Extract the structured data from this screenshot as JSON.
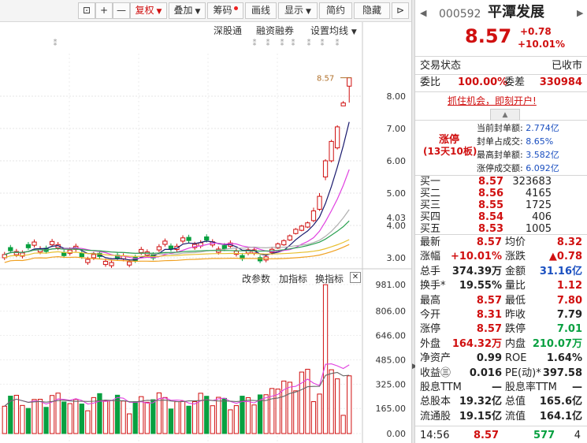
{
  "toolbar": {
    "icon_reset": "⊡",
    "icon_plus": "+",
    "icon_minus": "—",
    "fuquan": "复权",
    "diejia": "叠加",
    "chouma": "筹码",
    "huaxian": "画线",
    "xianshi": "显示",
    "jianyue": "简约",
    "yincang": "隐藏",
    "icon_next": "⊳"
  },
  "main_chart": {
    "menu": [
      "深股通",
      "融资融券",
      "设置均线"
    ],
    "price_ticks": [
      "8.00",
      "7.00",
      "6.00",
      "5.00",
      "4.03",
      "4.00",
      "3.00"
    ],
    "last_price_label": "8.57"
  },
  "sub_chart": {
    "menu": [
      "改参数",
      "加指标",
      "换指标"
    ],
    "vol_ticks": [
      "981.00",
      "806.00",
      "646.00",
      "485.00",
      "325.00",
      "165.00",
      "0.00"
    ]
  },
  "header": {
    "code": "000592",
    "name": "平潭发展",
    "price": "8.57",
    "change": "+0.78",
    "pct": "+10.01%"
  },
  "status": {
    "label": "交易状态",
    "value": "已收市"
  },
  "weibi": {
    "label1": "委比",
    "value1": "100.00%",
    "label2": "委差",
    "value2": "330984"
  },
  "promo": "抓住机会，即刻开户!",
  "limit": {
    "title": "涨停",
    "sub": "(13天10板)",
    "rows": [
      {
        "label": "当前封单额:",
        "value": "2.774亿"
      },
      {
        "label": "封单占成交:",
        "value": "8.65%"
      },
      {
        "label": "最高封单额:",
        "value": "3.582亿"
      },
      {
        "label": "涨停成交额:",
        "value": "6.092亿"
      }
    ]
  },
  "book": [
    {
      "label": "买一",
      "price": "8.57",
      "vol": "323683"
    },
    {
      "label": "买二",
      "price": "8.56",
      "vol": "4165"
    },
    {
      "label": "买三",
      "price": "8.55",
      "vol": "1725"
    },
    {
      "label": "买四",
      "price": "8.54",
      "vol": "406"
    },
    {
      "label": "买五",
      "price": "8.53",
      "vol": "1005"
    }
  ],
  "quotes": [
    {
      "l1": "最新",
      "v1": "8.57",
      "c1": "red",
      "l2": "均价",
      "v2": "8.32",
      "c2": "red"
    },
    {
      "l1": "涨幅",
      "v1": "+10.01%",
      "c1": "red",
      "l2": "涨跌",
      "v2": "▲0.78",
      "c2": "red"
    },
    {
      "l1": "总手",
      "v1": "374.39万",
      "c1": "",
      "l2": "金额",
      "v2": "31.16亿",
      "c2": "blue"
    },
    {
      "l1": "换手*",
      "v1": "19.55%",
      "c1": "",
      "l2": "量比",
      "v2": "1.12",
      "c2": "red"
    },
    {
      "l1": "最高",
      "v1": "8.57",
      "c1": "red",
      "l2": "最低",
      "v2": "7.80",
      "c2": "red"
    },
    {
      "l1": "今开",
      "v1": "8.31",
      "c1": "red",
      "l2": "昨收",
      "v2": "7.79",
      "c2": ""
    },
    {
      "l1": "涨停",
      "v1": "8.57",
      "c1": "red",
      "l2": "跌停",
      "v2": "7.01",
      "c2": "green"
    },
    {
      "l1": "外盘",
      "v1": "164.32万",
      "c1": "red",
      "l2": "内盘",
      "v2": "210.07万",
      "c2": "green"
    },
    {
      "l1": "净资产",
      "v1": "0.99",
      "c1": "",
      "l2": "ROE",
      "v2": "1.64%",
      "c2": ""
    },
    {
      "l1": "收益㊂",
      "v1": "0.016",
      "c1": "",
      "l2": "PE(动)*",
      "v2": "397.58",
      "c2": ""
    },
    {
      "l1": "股息TTM",
      "v1": "—",
      "c1": "",
      "l2": "股息率TTM",
      "v2": "—",
      "c2": ""
    },
    {
      "l1": "总股本",
      "v1": "19.32亿",
      "c1": "",
      "l2": "总值",
      "v2": "165.6亿",
      "c2": ""
    },
    {
      "l1": "流通股",
      "v1": "19.15亿",
      "c1": "",
      "l2": "流值",
      "v2": "164.1亿",
      "c2": ""
    }
  ],
  "tick": {
    "time": "14:56",
    "price": "8.57",
    "vol": "577",
    "n": "4"
  },
  "colors": {
    "up": "#d01010",
    "down": "#08a040",
    "blue": "#1a4fc0",
    "ma5": "#1a1a6e",
    "ma10": "#e040e0",
    "ma20": "#e8c030",
    "ma30": "#2aa050"
  },
  "chart_data": {
    "type": "candlestick",
    "price_axis": {
      "min": 3.0,
      "max": 8.57,
      "ticks": [
        3.0,
        4.0,
        4.03,
        5.0,
        6.0,
        7.0,
        8.0
      ]
    },
    "candles_tail": [
      {
        "o": 4.15,
        "c": 4.45,
        "h": 4.55,
        "l": 4.1
      },
      {
        "o": 4.5,
        "c": 4.9,
        "h": 5.0,
        "l": 4.45
      },
      {
        "o": 5.5,
        "c": 6.0,
        "h": 6.05,
        "l": 5.4
      },
      {
        "o": 6.0,
        "c": 6.6,
        "h": 6.65,
        "l": 5.95
      },
      {
        "o": 6.4,
        "c": 7.05,
        "h": 7.1,
        "l": 6.35
      },
      {
        "o": 7.7,
        "c": 7.79,
        "h": 7.85,
        "l": 7.7
      },
      {
        "o": 8.31,
        "c": 8.57,
        "h": 8.57,
        "l": 7.8
      }
    ],
    "volume_axis": {
      "min": 0,
      "max": 981,
      "ticks": [
        0,
        165,
        325,
        485,
        646,
        806,
        981
      ]
    }
  }
}
